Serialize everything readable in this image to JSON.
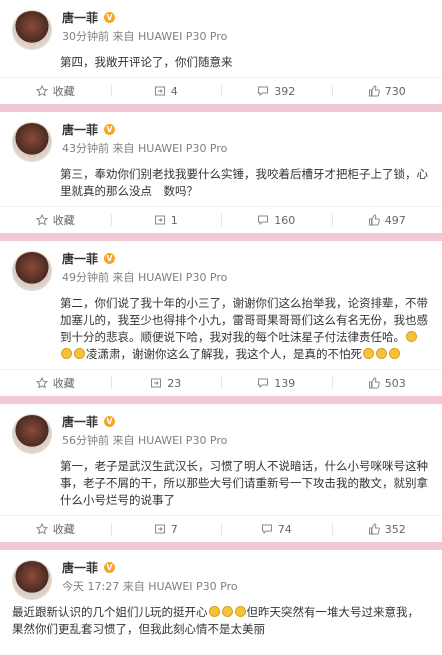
{
  "posts": [
    {
      "author": "唐一菲",
      "time": "30分钟前",
      "source": "来自 HUAWEI P30 Pro",
      "text": "第四，我敞开评论了，你们随意来",
      "collect_label": "收藏",
      "forward": "4",
      "comment": "392",
      "like": "730"
    },
    {
      "author": "唐一菲",
      "time": "43分钟前",
      "source": "来自 HUAWEI P30 Pro",
      "text": "第三，奉劝你们别老找我要什么实锤，我咬着后槽牙才把柜子上了锁，心里就真的那么没点　数吗？",
      "collect_label": "收藏",
      "forward": "1",
      "comment": "160",
      "like": "497"
    },
    {
      "author": "唐一菲",
      "time": "49分钟前",
      "source": "来自 HUAWEI P30 Pro",
      "text_a": "第二，你们说了我十年的小三了，谢谢你们这么抬举我，论资排辈，不带加塞儿的，我至少也得排个小九，雷哥哥果哥哥们这么有名无份，我也感到十分的悲哀。顺便说下哈，我对我的每个吐沫星子付法律责任哈。",
      "text_b": "凌潇肃，谢谢你这么了解我，我这个人，是真的不怕死",
      "collect_label": "收藏",
      "forward": "23",
      "comment": "139",
      "like": "503"
    },
    {
      "author": "唐一菲",
      "time": "56分钟前",
      "source": "来自 HUAWEI P30 Pro",
      "text": "第一，老子是武汉生武汉长，习惯了明人不说暗话，什么小号咪咪号这种事，老子不屑的干，所以那些大号们请重新号一下攻击我的散文，就别拿什么小号烂号的说事了",
      "collect_label": "收藏",
      "forward": "7",
      "comment": "74",
      "like": "352"
    },
    {
      "author": "唐一菲",
      "time": "今天 17:27",
      "source": "来自 HUAWEI P30 Pro",
      "text_a": "最近跟新认识的几个姐们儿玩的挺开心",
      "text_b": "但昨天突然有一堆大号过来意我，果然你们更乱套习惯了，但我此刻心情不是太美丽"
    }
  ],
  "colors": {
    "separator": "#f2c9d2",
    "badge": "#f6a623"
  }
}
